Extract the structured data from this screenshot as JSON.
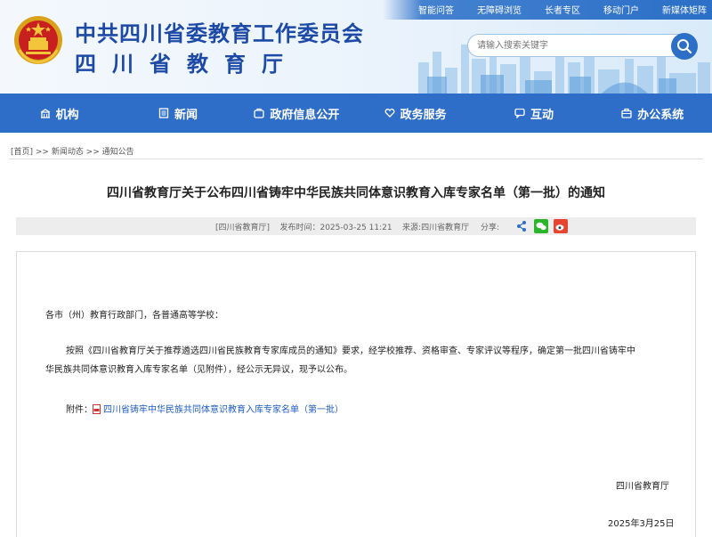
{
  "header": {
    "title_main": "中共四川省委教育工作委员会",
    "title_sub": "四川省教育厅",
    "toplinks": [
      "智能问答",
      "无障碍浏览",
      "长者专区",
      "移动门户",
      "新媒体矩阵"
    ],
    "search_placeholder": "请输入搜索关键字"
  },
  "nav": [
    {
      "label": "机构",
      "icon": "building-icon"
    },
    {
      "label": "新闻",
      "icon": "newspaper-icon"
    },
    {
      "label": "政府信息公开",
      "icon": "folder-icon"
    },
    {
      "label": "政务服务",
      "icon": "heart-hands-icon"
    },
    {
      "label": "互动",
      "icon": "chat-icon"
    },
    {
      "label": "办公系统",
      "icon": "office-icon"
    }
  ],
  "breadcrumb": "[首页] >> 新闻动态 >> 通知公告",
  "article": {
    "title": "四川省教育厅关于公布四川省铸牢中华民族共同体意识教育入库专家名单（第一批）的通知",
    "source_tag": "[四川省教育厅]",
    "publish_time": "发布时间：2025-03-25 11:21",
    "source": "来源:四川省教育厅",
    "share_label": "分享:",
    "salutation": "各市（州）教育行政部门，各普通高等学校：",
    "body_line1": "按照《四川省教育厅关于推荐遴选四川省民族教育专家库成员的通知》要求，经学校推荐、资格审查、专家评议等程序，确定第一批四川省铸牢中",
    "body_line2": "华民族共同体意识教育入库专家名单（见附件），经公示无异议，现予以公布。",
    "attachment_label": "附件：",
    "attachment_link": "四川省铸牢中华民族共同体意识教育入库专家名单（第一批）",
    "signature": "四川省教育厅",
    "date": "2025年3月25日"
  },
  "colors": {
    "nav_bg": "#2e6ec9",
    "title_blue": "#1d4aa6",
    "link": "#1f5cc4"
  }
}
